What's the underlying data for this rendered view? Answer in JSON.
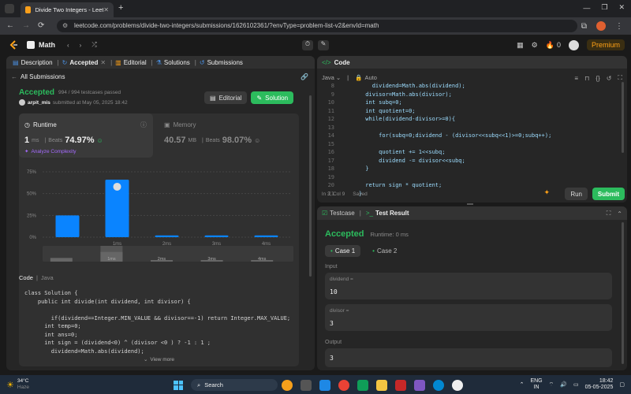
{
  "browser": {
    "tab_title": "Divide Two Integers - LeetCode",
    "url": "leetcode.com/problems/divide-two-integers/submissions/1626102361/?envType=problem-list-v2&envId=math"
  },
  "lcnav": {
    "list_title": "Math",
    "coins": "0",
    "premium": "Premium"
  },
  "left_tabs": [
    "Description",
    "Accepted",
    "Editorial",
    "Solutions",
    "Submissions"
  ],
  "submission": {
    "back_label": "All Submissions",
    "status": "Accepted",
    "passed": "994 / 994 testcases passed",
    "user": "arpit_mis",
    "submitted_at": "submitted at May 05, 2025 18:42",
    "editorial_btn": "Editorial",
    "solution_btn": "Solution"
  },
  "runtime": {
    "label": "Runtime",
    "value": "1",
    "unit": "ms",
    "beats_label": "Beats",
    "beats": "74.97%",
    "analyze": "Analyze Complexity"
  },
  "memory": {
    "label": "Memory",
    "value": "40.57",
    "unit": "MB",
    "beats_label": "Beats",
    "beats": "98.07%"
  },
  "chart_data": {
    "type": "bar",
    "categories": [
      "0ms",
      "1ms",
      "2ms",
      "3ms",
      "4ms"
    ],
    "tick_labels": [
      "",
      "1ms",
      "2ms",
      "3ms",
      "4ms"
    ],
    "values": [
      25,
      66,
      2,
      2,
      2
    ],
    "highlight_index": 1,
    "y_ticks": [
      "75%",
      "50%",
      "25%",
      "0%"
    ],
    "ylim": [
      0,
      75
    ],
    "color": "#0a84ff",
    "mini_labels": [
      "",
      "1ms",
      "2ms",
      "3ms",
      "4ms"
    ]
  },
  "code_section": {
    "label": "Code",
    "lang": "Java",
    "view_more": "View more",
    "lines": [
      "class Solution {",
      "    public int divide(int dividend, int divisor) {",
      "",
      "        if(dividend==Integer.MIN_VALUE && divisor==-1) return Integer.MAX_VALUE;",
      "      int temp=0;",
      "      int ans=0;",
      "      int sign = (dividend<0) ^ (divisor <0 ) ? -1 : 1 ;",
      "        dividend=Math.abs(dividend);"
    ]
  },
  "editor": {
    "title": "Code",
    "lang": "Java",
    "mode": "Auto",
    "status": "ln 3, Col 9",
    "saved": "Saved",
    "run": "Run",
    "submit": "Submit",
    "lines": [
      {
        "n": "8",
        "t": "        dividend=Math.abs(dividend);"
      },
      {
        "n": "9",
        "t": "      divisor=Math.abs(divisor);"
      },
      {
        "n": "10",
        "t": "      int subq=0;"
      },
      {
        "n": "11",
        "t": "      int quotient=0;"
      },
      {
        "n": "12",
        "t": "      while(dividend-divisor>=0){"
      },
      {
        "n": "13",
        "t": ""
      },
      {
        "n": "14",
        "t": "          for(subq=0;dividend - (divisor<<subq<<1)>=0;subq++);"
      },
      {
        "n": "15",
        "t": ""
      },
      {
        "n": "16",
        "t": "          quotient += 1<<subq;"
      },
      {
        "n": "17",
        "t": "          dividend -= divisor<<subq;"
      },
      {
        "n": "18",
        "t": "      }"
      },
      {
        "n": "19",
        "t": ""
      },
      {
        "n": "20",
        "t": "      return sign * quotient;"
      },
      {
        "n": "21",
        "t": "    }"
      }
    ]
  },
  "result": {
    "tab_testcase": "Testcase",
    "tab_result": "Test Result",
    "status": "Accepted",
    "runtime": "Runtime: 0 ms",
    "case1": "Case 1",
    "case2": "Case 2",
    "input_label": "Input",
    "var1": "dividend =",
    "val1": "10",
    "var2": "divisor =",
    "val2": "3",
    "output_label": "Output",
    "output": "3"
  },
  "taskbar": {
    "temp": "34°C",
    "weather": "Haze",
    "search": "Search",
    "lang1": "ENG",
    "lang2": "IN",
    "time": "18:42",
    "date": "05-05-2025"
  }
}
